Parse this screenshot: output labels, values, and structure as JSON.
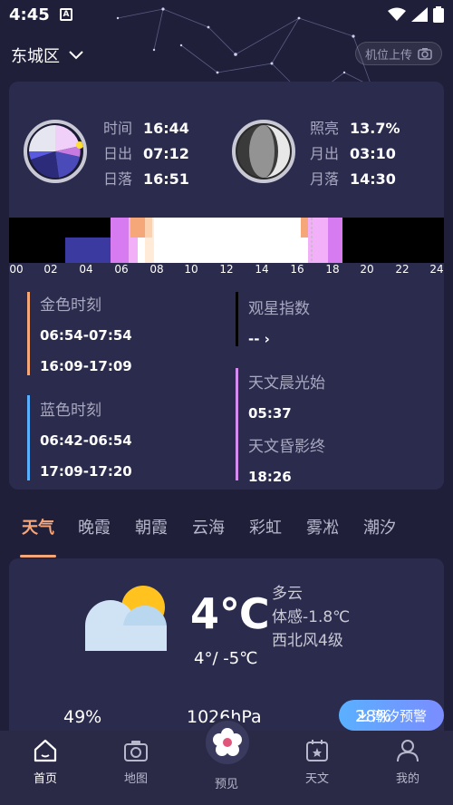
{
  "status_bar": {
    "time": "4:45",
    "notif_letter": "A"
  },
  "header": {
    "location": "东城区",
    "upload_label": "机位上传"
  },
  "sun": {
    "time_label": "时间",
    "time_value": "16:44",
    "rise_label": "日出",
    "rise_value": "07:12",
    "set_label": "日落",
    "set_value": "16:51"
  },
  "moon": {
    "illum_label": "照亮",
    "illum_value": "13.7%",
    "rise_label": "月出",
    "rise_value": "03:10",
    "set_label": "月落",
    "set_value": "14:30"
  },
  "timeline_ticks": [
    "00",
    "02",
    "04",
    "06",
    "08",
    "10",
    "12",
    "14",
    "16",
    "18",
    "20",
    "22",
    "24"
  ],
  "golden_hour": {
    "title": "金色时刻",
    "morning": "06:54-07:54",
    "evening": "16:09-17:09",
    "color": "#f6a77a"
  },
  "blue_hour": {
    "title": "蓝色时刻",
    "morning": "06:42-06:54",
    "evening": "17:09-17:20",
    "color": "#5ab0ff"
  },
  "stargazing": {
    "title": "观星指数",
    "value": "-- ›",
    "color": "#000000"
  },
  "astro_dawn": {
    "title": "天文晨光始",
    "value": "05:37",
    "color": "#d58cf0"
  },
  "astro_dusk": {
    "title": "天文昏影终",
    "value": "18:26"
  },
  "tabs": [
    "天气",
    "晚霞",
    "朝霞",
    "云海",
    "彩虹",
    "雾凇",
    "潮汐"
  ],
  "active_tab": "天气",
  "weather": {
    "temperature": "4℃",
    "range": "4°/ -5℃",
    "condition": "多云",
    "feels_like": "体感-1.8℃",
    "wind": "西北风4级",
    "humidity": "49%",
    "pressure": "1026hPa",
    "tide_alert": "潮汐预警",
    "overlay_pct": "28%"
  },
  "nav": [
    {
      "label": "首页",
      "icon": "home-icon"
    },
    {
      "label": "地图",
      "icon": "camera-icon"
    },
    {
      "label": "预见",
      "icon": "flower-icon"
    },
    {
      "label": "天文",
      "icon": "calendar-star-icon"
    },
    {
      "label": "我的",
      "icon": "user-icon"
    }
  ]
}
